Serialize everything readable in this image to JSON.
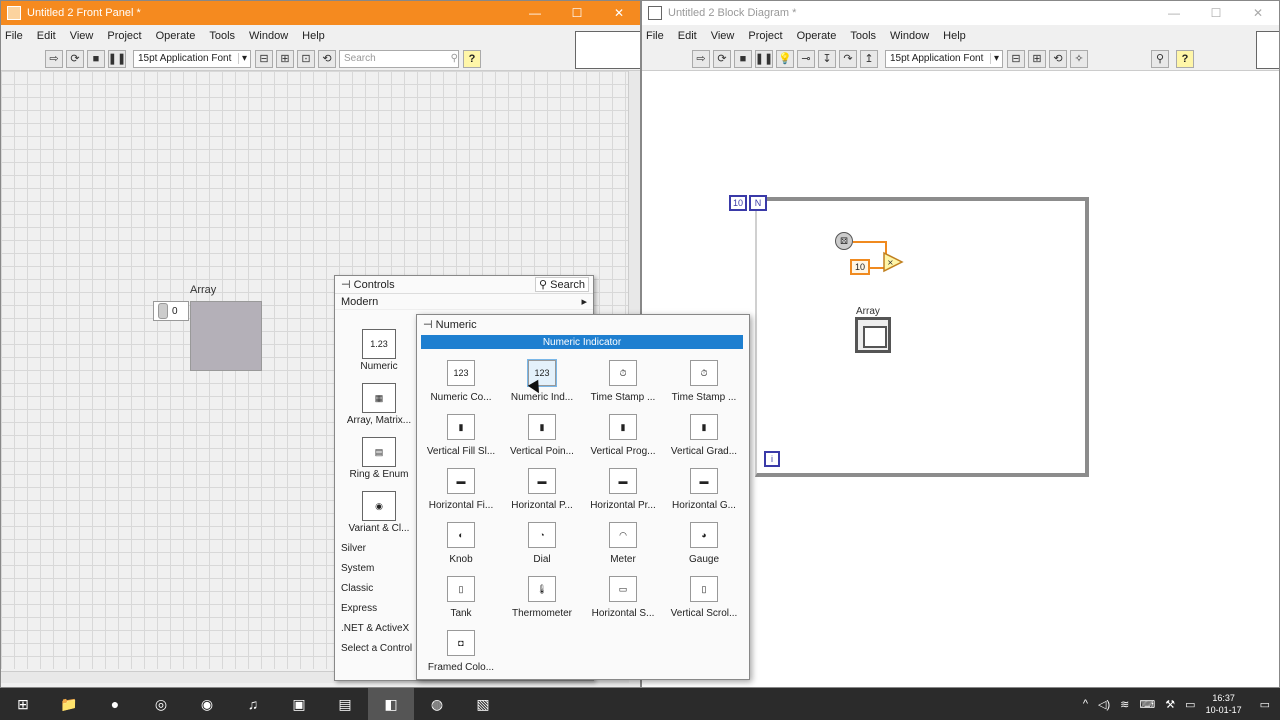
{
  "front_panel": {
    "title": "Untitled 2 Front Panel *",
    "menu": [
      "File",
      "Edit",
      "View",
      "Project",
      "Operate",
      "Tools",
      "Window",
      "Help"
    ],
    "font": "15pt Application Font",
    "search_placeholder": "Search",
    "array_label": "Array",
    "array_index": "0"
  },
  "block_diagram": {
    "title": "Untitled 2 Block Diagram *",
    "menu": [
      "File",
      "Edit",
      "View",
      "Project",
      "Operate",
      "Tools",
      "Window",
      "Help"
    ],
    "font": "15pt Application Font",
    "loop_count": "10",
    "loop_n": "N",
    "loop_index": "i",
    "constant": "10",
    "array_label": "Array"
  },
  "controls_palette": {
    "title": "Controls",
    "search": "Search",
    "modern": "Modern",
    "categories": [
      "Numeric",
      "Array, Matrix...",
      "Ring & Enum",
      "Variant & Cl..."
    ],
    "list": [
      "Silver",
      "System",
      "Classic",
      "Express",
      ".NET & ActiveX",
      "Select a Control"
    ]
  },
  "numeric_palette": {
    "title": "Numeric",
    "tooltip": "Numeric Indicator",
    "items": [
      "Numeric Co...",
      "Numeric Ind...",
      "Time Stamp ...",
      "Time Stamp ...",
      "Vertical Fill Sl...",
      "Vertical Poin...",
      "Vertical Prog...",
      "Vertical Grad...",
      "Horizontal Fi...",
      "Horizontal P...",
      "Horizontal Pr...",
      "Horizontal G...",
      "Knob",
      "Dial",
      "Meter",
      "Gauge",
      "Tank",
      "Thermometer",
      "Horizontal S...",
      "Vertical Scrol...",
      "Framed Colo..."
    ]
  },
  "taskbar": {
    "time": "16:37",
    "date": "10-01-17"
  }
}
